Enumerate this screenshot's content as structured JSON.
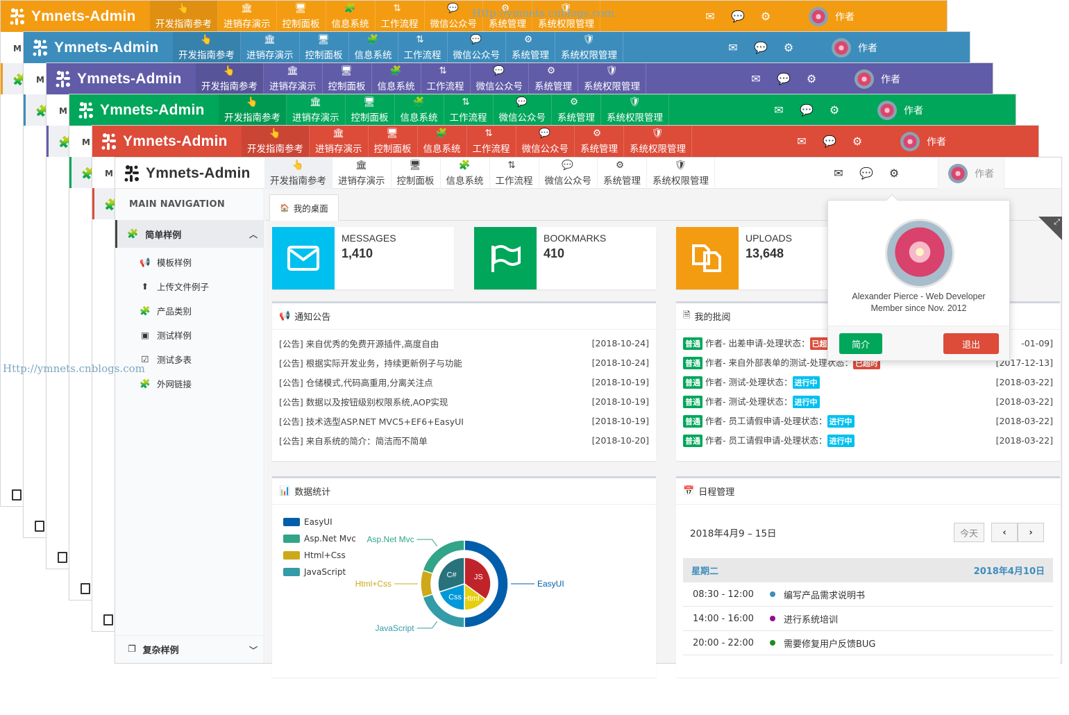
{
  "app_title": "Ymnets-Admin",
  "watermark": "Http://ymnets.cnblogs.com",
  "menu": [
    "开发指南参考",
    "进销存演示",
    "控制面板",
    "信息系统",
    "工作流程",
    "微信公众号",
    "系统管理",
    "系统权限管理"
  ],
  "user_label": "作者",
  "theme_colors": [
    "#f39c12",
    "#3c8dbc",
    "#605ca8",
    "#00a65a",
    "#dd4b39"
  ],
  "stacked_side_letter": "M",
  "sidebar": {
    "title": "MAIN NAVIGATION",
    "group": "简单样例",
    "items": [
      "模板样例",
      "上传文件例子",
      "产品类别",
      "测试样例",
      "测试多表",
      "外网链接"
    ],
    "bottom": "复杂样例"
  },
  "tab": {
    "label": "我的桌面"
  },
  "stats": [
    {
      "label": "MESSAGES",
      "value": "1,410",
      "color": "#00c0ef"
    },
    {
      "label": "BOOKMARKS",
      "value": "410",
      "color": "#00a65a"
    },
    {
      "label": "UPLOADS",
      "value": "13,648",
      "color": "#f39c12"
    }
  ],
  "notice": {
    "title": "通知公告",
    "rows": [
      {
        "text": "[公告] 来自优秀的免费开源插件,高度自由",
        "date": "[2018-10-24]"
      },
      {
        "text": "[公告] 根据实际开发业务，持续更新例子与功能",
        "date": "[2018-10-24]"
      },
      {
        "text": "[公告] 仓储模式,代码高重用,分离关注点",
        "date": "[2018-10-19]"
      },
      {
        "text": "[公告] 数据以及按钮级别权限系统,AOP实现",
        "date": "[2018-10-19]"
      },
      {
        "text": "[公告] 技术选型ASP.NET MVC5+EF6+EasyUI",
        "date": "[2018-10-19]"
      },
      {
        "text": "[公告] 来自系统的简介：简洁而不简单",
        "date": "[2018-10-20]"
      }
    ]
  },
  "review": {
    "title": "我的批阅",
    "rows": [
      {
        "tag": "普通",
        "text": "作者- 出差申请-处理状态：",
        "status": "已超",
        "date": "-01-09]"
      },
      {
        "tag": "普通",
        "text": "作者- 来自外部表单的测试-处理状态：",
        "status": "已超时",
        "date": "[2017-12-13]"
      },
      {
        "tag": "普通",
        "text": "作者- 测试-处理状态：",
        "status": "进行中",
        "date": "[2018-03-22]"
      },
      {
        "tag": "普通",
        "text": "作者- 测试-处理状态：",
        "status": "进行中",
        "date": "[2018-03-22]"
      },
      {
        "tag": "普通",
        "text": "作者- 员工请假申请-处理状态：",
        "status": "进行中",
        "date": "[2018-03-22]"
      },
      {
        "tag": "普通",
        "text": "作者- 员工请假申请-处理状态：",
        "status": "进行中",
        "date": "[2018-03-22]"
      }
    ]
  },
  "stats_box": {
    "title": "数据统计"
  },
  "chart_data": {
    "type": "pie",
    "legend": [
      "EasyUI",
      "Asp.Net Mvc",
      "Html+Css",
      "JavaScript"
    ],
    "colors": [
      "#005eaa",
      "#339ca8",
      "#cda819",
      "#32a487"
    ],
    "outer": [
      {
        "name": "EasyUI",
        "value": 50,
        "color": "#005eaa"
      },
      {
        "name": "JavaScript",
        "value": 20,
        "color": "#339ca8"
      },
      {
        "name": "Html+Css",
        "value": 10,
        "color": "#cda819"
      },
      {
        "name": "Asp.Net Mvc",
        "value": 20,
        "color": "#32a487"
      }
    ],
    "inner": [
      {
        "name": "JS",
        "value": 35,
        "color": "#c1232b"
      },
      {
        "name": "Html",
        "value": 15,
        "color": "#e5cf0d"
      },
      {
        "name": "Css",
        "value": 20,
        "color": "#0098d9"
      },
      {
        "name": "C#",
        "value": 30,
        "color": "#27727b"
      }
    ]
  },
  "calendar": {
    "title": "日程管理",
    "range": "2018年4月9 – 15日",
    "today_btn": "今天",
    "prev": "‹",
    "next": "›",
    "weekday": "星期二",
    "date": "2018年4月10日",
    "events": [
      {
        "time": "08:30 - 12:00",
        "text": "编写产品需求说明书",
        "color": "#3c8dbc"
      },
      {
        "time": "14:00 - 16:00",
        "text": "进行系统培训",
        "color": "#8e0e8e"
      },
      {
        "time": "20:00 - 22:00",
        "text": "需要修复用户反馈BUG",
        "color": "#1f8c1f"
      }
    ]
  },
  "user_popup": {
    "name": "Alexander Pierce - Web Developer",
    "since": "Member since Nov. 2012",
    "profile_btn": "简介",
    "logout_btn": "退出"
  }
}
